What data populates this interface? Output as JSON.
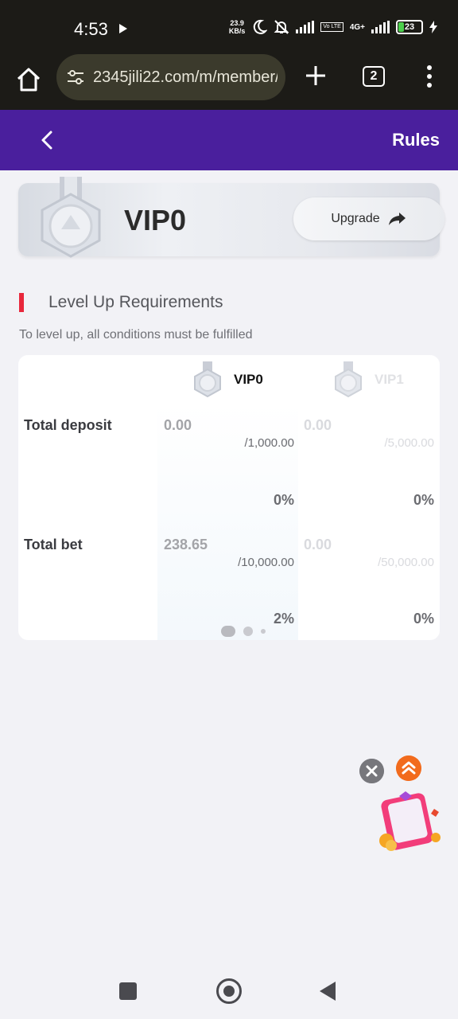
{
  "status_bar": {
    "time": "4:53",
    "net_speed_value": "23.9",
    "net_speed_unit": "KB/s",
    "volte": "Vo LTE",
    "network": "4G+",
    "battery": "23"
  },
  "browser": {
    "url": "2345jili22.com/m/member/",
    "tab_count": "2"
  },
  "header": {
    "rules_label": "Rules"
  },
  "vip_card": {
    "level": "VIP0",
    "upgrade_label": "Upgrade"
  },
  "section": {
    "title": "Level Up Requirements",
    "subtitle": "To level up, all conditions must be fulfilled"
  },
  "requirements": {
    "columns": [
      "VIP0",
      "VIP1"
    ],
    "rows": [
      {
        "label": "Total deposit",
        "vip0": {
          "current": "0.00",
          "target": "/1,000.00",
          "percent": "0%"
        },
        "vip1": {
          "current": "0.00",
          "target": "/5,000.00",
          "percent": "0%"
        }
      },
      {
        "label": "Total bet",
        "vip0": {
          "current": "238.65",
          "target": "/10,000.00",
          "percent": "2%"
        },
        "vip1": {
          "current": "0.00",
          "target": "/50,000.00",
          "percent": "0%"
        }
      }
    ]
  },
  "icons": {
    "medal": "vip-medal-icon",
    "upgrade": "share-arrow-icon",
    "close": "close-icon",
    "scroll_top": "double-chevron-up-icon",
    "promo": "gift-box-icon"
  },
  "colors": {
    "header_bg": "#4a1f9d",
    "accent_red": "#e8273b",
    "scroll_top_orange": "#f26b1d"
  }
}
